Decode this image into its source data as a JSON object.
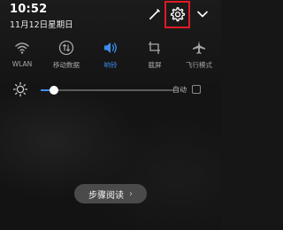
{
  "status": {
    "time": "10:52",
    "date": "11月12日星期日"
  },
  "header_icons": {
    "edit": "edit-pencil-icon",
    "settings": "gear-icon",
    "expand": "chevron-down-icon",
    "highlight_color": "#e01b24"
  },
  "toggles": [
    {
      "label": "WLAN",
      "icon": "wifi-icon",
      "active": false
    },
    {
      "label": "移动数据",
      "icon": "mobile-data-icon",
      "active": false
    },
    {
      "label": "响铃",
      "icon": "speaker-icon",
      "active": true
    },
    {
      "label": "截屏",
      "icon": "screenshot-icon",
      "active": false
    },
    {
      "label": "飞行模式",
      "icon": "airplane-icon",
      "active": false
    }
  ],
  "brightness": {
    "level": 0.1,
    "auto_label": "自动",
    "auto_enabled": false
  },
  "colors": {
    "accent": "#3b8ff0",
    "inactive": "#a8a8a8"
  },
  "button": {
    "label": "步骤阅读",
    "chevron": "›"
  }
}
